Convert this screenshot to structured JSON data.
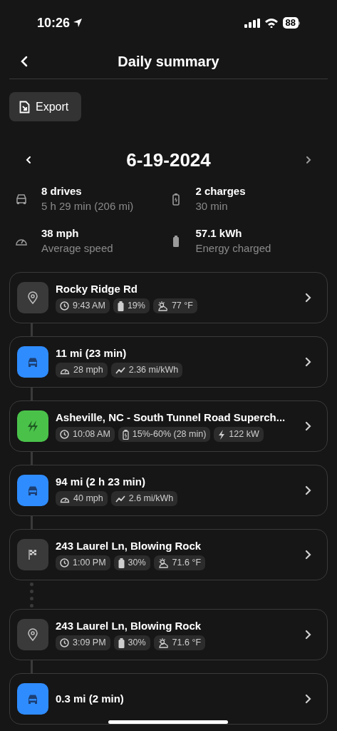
{
  "status_bar": {
    "time": "10:26",
    "battery": "88"
  },
  "header": {
    "title": "Daily summary"
  },
  "export_button": {
    "label": "Export"
  },
  "date_nav": {
    "date": "6-19-2024"
  },
  "stats": [
    {
      "kind": "car",
      "value": "8 drives",
      "caption": "5 h 29 min (206 mi)"
    },
    {
      "kind": "charge",
      "value": "2 charges",
      "caption": "30 min"
    },
    {
      "kind": "speed",
      "value": "38 mph",
      "caption": "Average speed"
    },
    {
      "kind": "energy",
      "value": "57.1 kWh",
      "caption": "Energy charged"
    }
  ],
  "timeline": [
    {
      "kind": "location",
      "title": "Rocky Ridge Rd",
      "connector_below": {
        "kind": "solid"
      },
      "chips": [
        {
          "kind": "time",
          "text": "9:43 AM"
        },
        {
          "kind": "battery",
          "text": "19%"
        },
        {
          "kind": "weather",
          "text": "77 °F"
        }
      ]
    },
    {
      "kind": "drive",
      "title": "11 mi (23 min)",
      "connector_below": {
        "kind": "solid"
      },
      "chips": [
        {
          "kind": "speed",
          "text": "28 mph"
        },
        {
          "kind": "efficiency",
          "text": "2.36 mi/kWh"
        }
      ]
    },
    {
      "kind": "charge",
      "title": "Asheville, NC - South Tunnel Road Superch...",
      "connector_below": {
        "kind": "solid"
      },
      "chips": [
        {
          "kind": "time",
          "text": "10:08 AM"
        },
        {
          "kind": "charge_range",
          "text": "15%-60% (28 min)"
        },
        {
          "kind": "power",
          "text": "122 kW"
        }
      ]
    },
    {
      "kind": "drive",
      "title": "94 mi (2 h 23 min)",
      "connector_below": {
        "kind": "solid"
      },
      "chips": [
        {
          "kind": "speed",
          "text": "40 mph"
        },
        {
          "kind": "efficiency",
          "text": "2.6 mi/kWh"
        }
      ]
    },
    {
      "kind": "destination",
      "title": "243 Laurel Ln, Blowing Rock",
      "connector_below": {
        "kind": "dotted"
      },
      "chips": [
        {
          "kind": "time",
          "text": "1:00 PM"
        },
        {
          "kind": "battery",
          "text": "30%"
        },
        {
          "kind": "weather",
          "text": "71.6 °F"
        }
      ]
    },
    {
      "kind": "location",
      "title": "243 Laurel Ln, Blowing Rock",
      "connector_below": {
        "kind": "solid"
      },
      "chips": [
        {
          "kind": "time",
          "text": "3:09 PM"
        },
        {
          "kind": "battery",
          "text": "30%"
        },
        {
          "kind": "weather",
          "text": "71.6 °F"
        }
      ]
    },
    {
      "kind": "drive",
      "title": "0.3 mi (2 min)"
    }
  ]
}
